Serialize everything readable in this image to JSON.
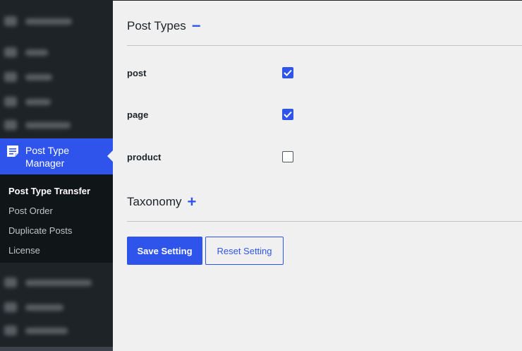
{
  "sidebar": {
    "blurred_top": [
      "Dashboard",
      "Posts",
      "Media",
      "Pages",
      "Comments"
    ],
    "active_item": {
      "label_line1": "Post Type",
      "label_line2": "Manager",
      "icon": "document-list-icon"
    },
    "submenu": [
      {
        "label": "Post Type Transfer",
        "current": true
      },
      {
        "label": "Post Order",
        "current": false
      },
      {
        "label": "Duplicate Posts",
        "current": false
      },
      {
        "label": "License",
        "current": false
      }
    ],
    "blurred_bottom": [
      "WooCommerce",
      "Products",
      "Payments"
    ]
  },
  "post_types": {
    "title": "Post Types",
    "toggle": "−",
    "items": [
      {
        "label": "post",
        "checked": true
      },
      {
        "label": "page",
        "checked": true
      },
      {
        "label": "product",
        "checked": false
      }
    ]
  },
  "taxonomy": {
    "title": "Taxonomy",
    "toggle": "+"
  },
  "buttons": {
    "save": "Save Setting",
    "reset": "Reset Setting"
  },
  "colors": {
    "accent": "#2f54eb",
    "sidebar": "#1d2327",
    "submenu": "#101517",
    "background": "#f0f0f1"
  }
}
